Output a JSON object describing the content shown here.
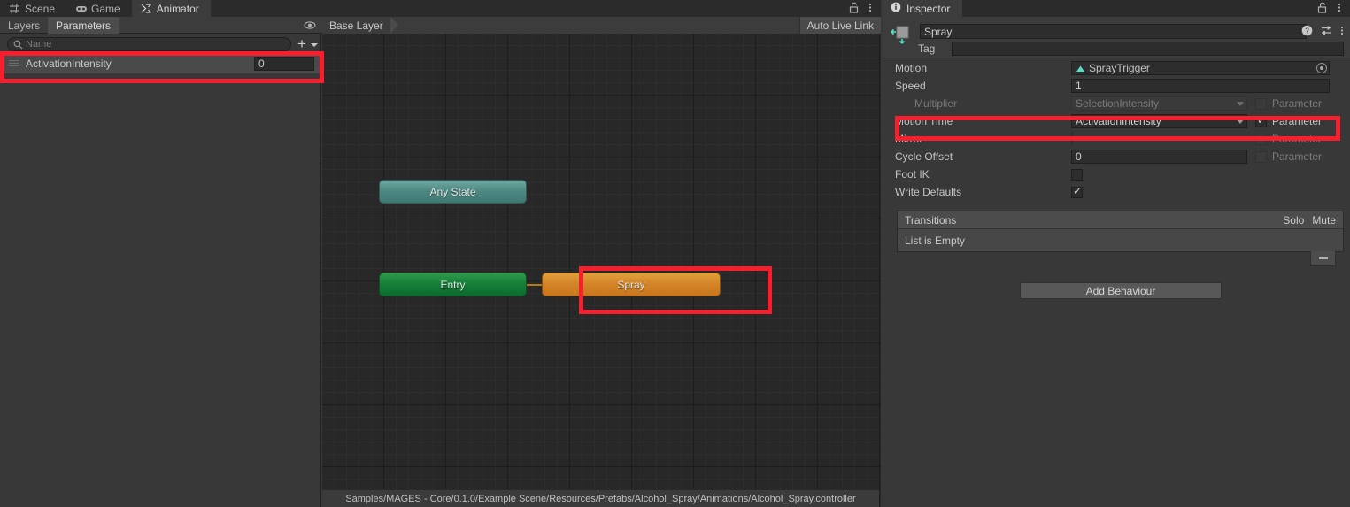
{
  "window": {
    "tabs": [
      {
        "label": "Scene",
        "icon": "grid-icon",
        "active": false
      },
      {
        "label": "Game",
        "icon": "gamepad-icon",
        "active": false
      },
      {
        "label": "Animator",
        "icon": "animator-icon",
        "active": true
      }
    ],
    "lock_icon": "lock-open-icon",
    "menu_icon": "kebab-menu-icon"
  },
  "animator": {
    "layer_tabs": [
      {
        "label": "Layers",
        "selected": false
      },
      {
        "label": "Parameters",
        "selected": true
      }
    ],
    "visibility_icon": "eye-icon",
    "breadcrumb": "Base Layer",
    "auto_live_link": "Auto Live Link",
    "search": {
      "placeholder": "Name",
      "value": "",
      "icon": "search-icon"
    },
    "add_button": "+",
    "parameters": [
      {
        "name": "ActivationIntensity",
        "value": "0",
        "type": "float"
      }
    ],
    "nodes": [
      {
        "id": "any-state",
        "label": "Any State",
        "color": "#4e8a84"
      },
      {
        "id": "entry",
        "label": "Entry",
        "color": "#17803a"
      },
      {
        "id": "spray",
        "label": "Spray",
        "color": "#d4862a",
        "selected": true
      }
    ],
    "status_path": "Samples/MAGES - Core/0.1.0/Example Scene/Resources/Prefabs/Alcohol_Spray/Animations/Alcohol_Spray.controller"
  },
  "inspector": {
    "tab_label": "Inspector",
    "tab_icon": "info-icon",
    "lock_icon": "lock-open-icon",
    "menu_icon": "kebab-menu-icon",
    "header": {
      "name_value": "Spray",
      "tag_label": "Tag",
      "tag_value": "",
      "thumb_icon": "animator-state-icon",
      "help_icon": "help-icon",
      "preset_icon": "preset-icon",
      "more_icon": "kebab-menu-icon"
    },
    "properties": [
      {
        "label": "Motion",
        "kind": "object",
        "value": "SprayTrigger",
        "icon": "animation-clip-icon",
        "picker_icon": "object-picker-icon"
      },
      {
        "label": "Speed",
        "kind": "text",
        "value": "1"
      },
      {
        "label": "Multiplier",
        "kind": "dropdown",
        "value": "SelectionIntensity",
        "checkbox_label": "Parameter",
        "checked": false,
        "disabled": true,
        "indent": true
      },
      {
        "label": "Motion Time",
        "kind": "dropdown",
        "value": "ActivationIntensity",
        "checkbox_label": "Parameter",
        "checked": true,
        "disabled": false,
        "highlighted": true
      },
      {
        "label": "Mirror",
        "kind": "checkbox",
        "checked": false,
        "checkbox_label": "Parameter",
        "param_checked": false,
        "disabled": true
      },
      {
        "label": "Cycle Offset",
        "kind": "text",
        "value": "0",
        "checkbox_label": "Parameter",
        "param_checked": false
      },
      {
        "label": "Foot IK",
        "kind": "checkbox",
        "checked": false
      },
      {
        "label": "Write Defaults",
        "kind": "checkbox",
        "checked": true
      }
    ],
    "transitions": {
      "title": "Transitions",
      "solo": "Solo",
      "mute": "Mute",
      "empty_text": "List is Empty",
      "remove_label": "−"
    },
    "add_behaviour": "Add Behaviour"
  },
  "colors": {
    "highlight": "#f51f2d",
    "accent_orange": "#d4862a",
    "accent_green": "#17803a",
    "accent_teal": "#4e8a84"
  }
}
